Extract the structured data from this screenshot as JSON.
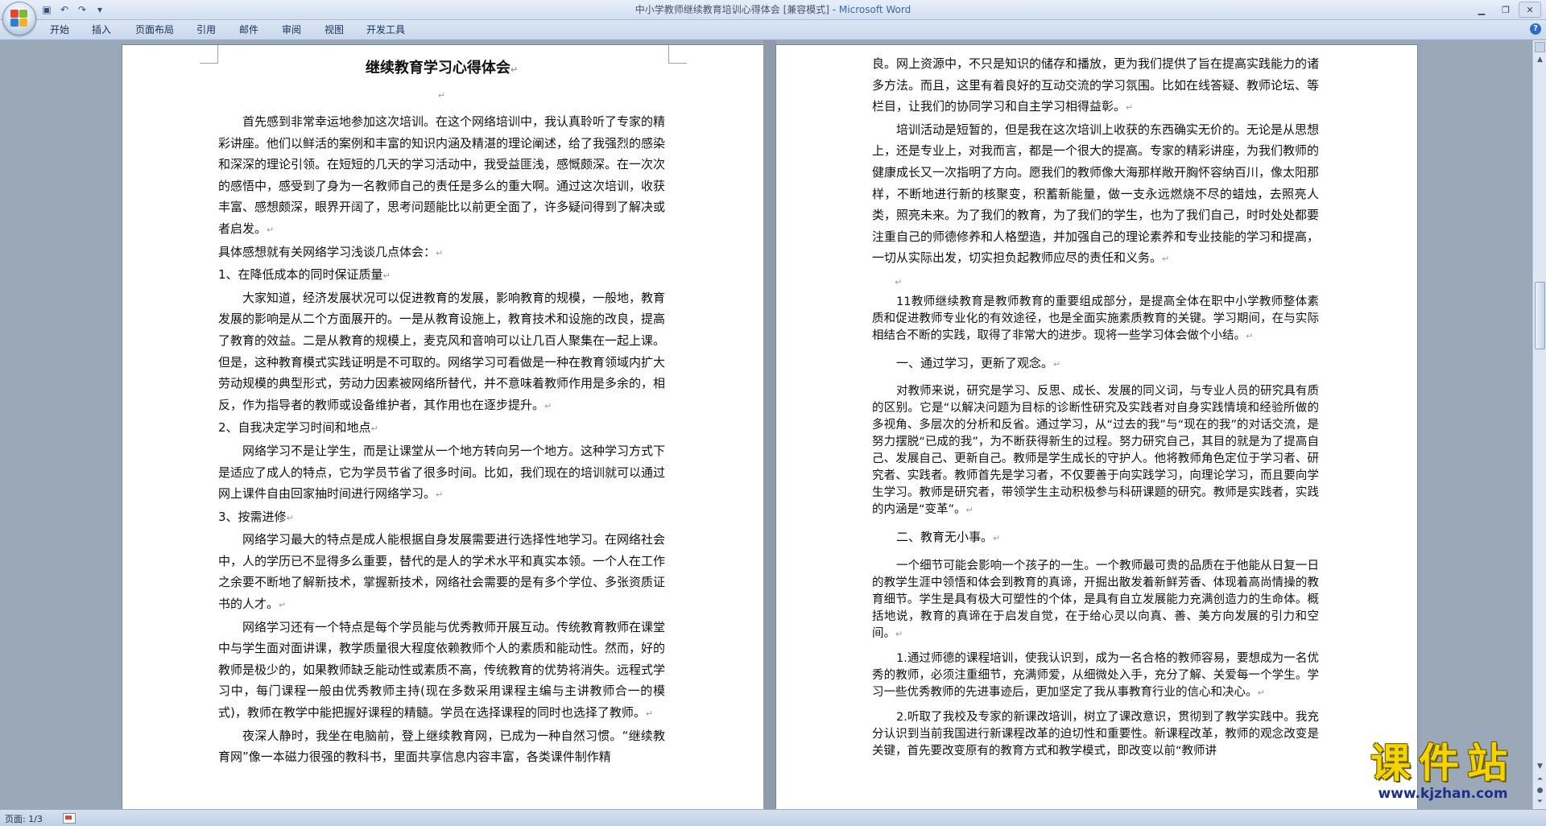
{
  "window": {
    "title": "中小学教师继续教育培训心得体会 [兼容模式] - ",
    "app": "Microsoft Word"
  },
  "qat": {
    "save_icon": "save-icon",
    "undo_icon": "undo-icon",
    "redo_icon": "redo-icon",
    "customize_icon": "customize-icon"
  },
  "menu": {
    "tabs": [
      "开始",
      "插入",
      "页面布局",
      "引用",
      "邮件",
      "审阅",
      "视图",
      "开发工具"
    ]
  },
  "doc": {
    "title": "继续教育学习心得体会",
    "left": {
      "p1": "首先感到非常幸运地参加这次培训。在这个网络培训中，我认真聆听了专家的精彩讲座。他们以鲜活的案例和丰富的知识内涵及精湛的理论阐述，给了我强烈的感染和深深的理论引领。在短短的几天的学习活动中，我受益匪浅，感慨颇深。在一次次的感悟中，感受到了身为一名教师自己的责任是多么的重大啊。通过这次培训，收获丰富、感想颇深，眼界开阔了，思考问题能比以前更全面了，许多疑问得到了解决或者启发。",
      "p2": "具体感想就有关网络学习浅谈几点体会：",
      "h1": "1、在降低成本的同时保证质量",
      "p3": "大家知道，经济发展状况可以促进教育的发展，影响教育的规模，一般地，教育发展的影响是从二个方面展开的。一是从教育设施上，教育技术和设施的改良，提高了教育的效益。二是从教育的规模上，麦克风和音响可以让几百人聚集在一起上课。但是，这种教育模式实践证明是不可取的。网络学习可看做是一种在教育领域内扩大劳动规模的典型形式，劳动力因素被网络所替代，并不意味着教师作用是多余的，相反，作为指导者的教师或设备维护者，其作用也在逐步提升。",
      "h2": "2、自我决定学习时间和地点",
      "p4": "网络学习不是让学生，而是让课堂从一个地方转向另一个地方。这种学习方式下是适应了成人的特点，它为学员节省了很多时间。比如，我们现在的培训就可以通过网上课件自由回家抽时间进行网络学习。",
      "h3": "3、按需进修",
      "p5": "网络学习最大的特点是成人能根据自身发展需要进行选择性地学习。在网络社会中，人的学历已不显得多么重要，替代的是人的学术水平和真实本领。一个人在工作之余要不断地了解新技术，掌握新技术，网络社会需要的是有多个学位、多张资质证书的人才。",
      "p6": "网络学习还有一个特点是每个学员能与优秀教师开展互动。传统教育教师在课堂中与学生面对面讲课，教学质量很大程度依赖教师个人的素质和能动性。然而，好的教师是极少的，如果教师缺乏能动性或素质不高，传统教育的优势将消失。远程式学习中，每门课程一般由优秀教师主持(现在多数采用课程主编与主讲教师合一的模式)，教师在教学中能把握好课程的精髓。学员在选择课程的同时也选择了教师。",
      "p7": "夜深人静时，我坐在电脑前，登上继续教育网，已成为一种自然习惯。“继续教育网”像一本磁力很强的教科书，里面共享信息内容丰富，各类课件制作精"
    },
    "right": {
      "p1": "良。网上资源中，不只是知识的储存和播放，更为我们提供了旨在提高实践能力的诸多方法。而且，这里有着良好的互动交流的学习氛围。比如在线答疑、教师论坛、等栏目，让我们的协同学习和自主学习相得益彰。",
      "p2": "培训活动是短暂的，但是我在这次培训上收获的东西确实无价的。无论是从思想上，还是专业上，对我而言，都是一个很大的提高。专家的精彩讲座，为我们教师的健康成长又一次指明了方向。愿我们的教师像大海那样敞开胸怀容纳百川，像太阳那样，不断地进行新的核聚变，积蓄新能量，做一支永远燃烧不尽的蜡烛，去照亮人类，照亮未来。为了我们的教育，为了我们的学生，也为了我们自己，时时处处都要注重自己的师德修养和人格塑造，并加强自己的理论素养和专业技能的学习和提高，一切从实际出发，切实担负起教师应尽的责任和义务。",
      "p3": "11教师继续教育是教师教育的重要组成部分，是提高全体在职中小学教师整体素质和促进教师专业化的有效途径，也是全面实施素质教育的关键。学习期间，在与实际相结合不断的实践，取得了非常大的进步。现将一些学习体会做个小结。",
      "h1": "一、通过学习，更新了观念。",
      "p4": "对教师来说，研究是学习、反思、成长、发展的同义词，与专业人员的研究具有质的区别。它是“以解决问题为目标的诊断性研究及实践者对自身实践情境和经验所做的多视角、多层次的分析和反省。通过学习，从“过去的我”与“现在的我”的对话交流，是努力摆脱“已成的我”，为不断获得新生的过程。努力研究自己，其目的就是为了提高自己、发展自己、更新自己。教师是学生成长的守护人。他将教师角色定位于学习者、研究者、实践者。教师首先是学习者，不仅要善于向实践学习，向理论学习，而且要向学生学习。教师是研究者，带领学生主动积极参与科研课题的研究。教师是实践者，实践的内涵是“变革”。",
      "h2": "二、教育无小事。",
      "p5": "一个细节可能会影响一个孩子的一生。一个教师最可贵的品质在于他能从日复一日的教学生涯中领悟和体会到教育的真谛，开掘出散发着新鲜芳香、体现着高尚情操的教育细节。学生是具有极大可塑性的个体，是具有自立发展能力充满创造力的生命体。概括地说，教育的真谛在于启发自觉，在于给心灵以向真、善、美方向发展的引力和空间。",
      "p6": "1.通过师德的课程培训，使我认识到，成为一名合格的教师容易，要想成为一名优秀的教师，必须注重细节，充满师爱，从细微处入手，充分了解、关爱每一个学生。学习一些优秀教师的先进事迹后，更加坚定了我从事教育行业的信心和决心。",
      "p7": "2.听取了我校及专家的新课改培训，树立了课改意识，贯彻到了教学实践中。我充分认识到当前我国进行新课程改革的迫切性和重要性。新课程改革，教师的观念改变是关键，首先要改变原有的教育方式和教学模式，即改变以前“教师讲"
    }
  },
  "status": {
    "pages": "页面: 1/3"
  },
  "watermark": {
    "cn": "课件站",
    "url": "www.kjzhan.com"
  }
}
